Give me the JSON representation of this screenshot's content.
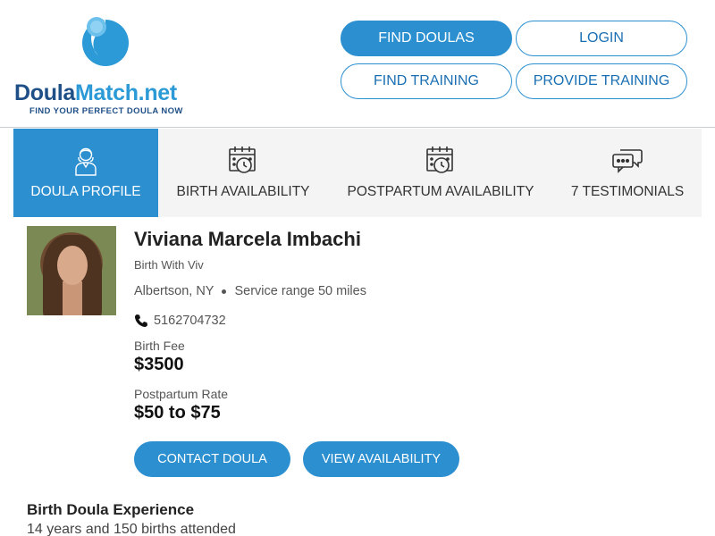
{
  "logo": {
    "word_part1": "Doula",
    "word_part2": "Match.net",
    "tagline": "FIND YOUR PERFECT DOULA NOW"
  },
  "nav": {
    "find_doulas": "FIND DOULAS",
    "login": "LOGIN",
    "find_training": "FIND TRAINING",
    "provide_training": "PROVIDE TRAINING"
  },
  "tabs": [
    {
      "label": "DOULA PROFILE",
      "icon": "person-icon",
      "active": true
    },
    {
      "label": "BIRTH AVAILABILITY",
      "icon": "calendar-clock-icon",
      "active": false
    },
    {
      "label": "POSTPARTUM AVAILABILITY",
      "icon": "calendar-clock-icon",
      "active": false
    },
    {
      "label": "7 TESTIMONIALS",
      "icon": "chat-bubbles-icon",
      "active": false
    }
  ],
  "profile": {
    "name": "Viviana Marcela Imbachi",
    "business": "Birth With Viv",
    "location": "Albertson, NY",
    "service_range": "Service range 50 miles",
    "phone": "5162704732",
    "birth_fee_label": "Birth Fee",
    "birth_fee": "$3500",
    "postpartum_label": "Postpartum Rate",
    "postpartum_rate": "$50 to $75",
    "contact_button": "CONTACT DOULA",
    "availability_button": "VIEW AVAILABILITY"
  },
  "experience": {
    "title": "Birth Doula Experience",
    "text": "14 years and 150 births attended"
  },
  "colors": {
    "accent": "#2b8fd0",
    "brand_dark": "#1f4f87",
    "brand_light": "#2b9ad6",
    "tab_bg": "#f4f4f4"
  }
}
